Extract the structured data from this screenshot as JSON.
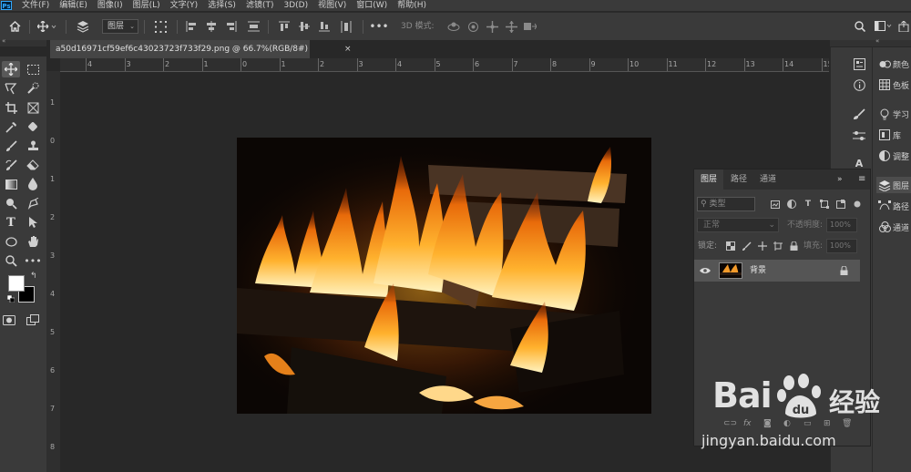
{
  "app": {
    "logo": "Ps"
  },
  "menu": [
    "文件(F)",
    "编辑(E)",
    "图像(I)",
    "图层(L)",
    "文字(Y)",
    "选择(S)",
    "滤镜(T)",
    "3D(D)",
    "视图(V)",
    "窗口(W)",
    "帮助(H)"
  ],
  "options": {
    "auto_select_target": "图层",
    "mode_3d_label": "3D 模式:",
    "icons": [
      "home-icon",
      "move-tool-icon",
      "layer-stack-icon",
      "transform-controls-icon",
      "align-left-icon",
      "align-center-icon",
      "align-right-icon",
      "distribute-icon",
      "align-top-icon",
      "align-middle-icon",
      "align-bottom-icon",
      "distribute-vertical-icon",
      "more-icon",
      "orbit-3d-icon",
      "roll-3d-icon",
      "pan-3d-icon",
      "slide-3d-icon",
      "scale-3d-icon",
      "search-icon",
      "workspace-icon",
      "share-icon"
    ]
  },
  "document": {
    "tab_title": "a50d16971cf59ef6c43023723f733f29.png @ 66.7%(RGB/8#) *",
    "close": "×"
  },
  "rulers": {
    "horizontal": [
      "4",
      "3",
      "2",
      "1",
      "0",
      "1",
      "2",
      "3",
      "4",
      "5",
      "6",
      "7",
      "8",
      "9",
      "10",
      "11",
      "12",
      "13",
      "14",
      "15"
    ],
    "vertical": [
      "1",
      "0",
      "1",
      "2",
      "3",
      "4",
      "5",
      "6",
      "7",
      "8"
    ]
  },
  "tools": [
    "move-tool",
    "marquee-tool",
    "lasso-tool",
    "quick-select-tool",
    "crop-tool",
    "frame-tool",
    "eyedropper-tool",
    "healing-brush-tool",
    "brush-tool",
    "clone-stamp-tool",
    "history-brush-tool",
    "eraser-tool",
    "gradient-tool",
    "blur-tool",
    "dodge-tool",
    "pen-tool",
    "type-tool",
    "path-select-tool",
    "ellipse-tool",
    "hand-tool",
    "zoom-tool",
    "more-tools",
    "quick-mask",
    "screen-mode"
  ],
  "colors": {
    "foreground": "#ffffff",
    "background": "#000000",
    "ui_bg": "#3a3a3a",
    "canvas_bg": "#282828"
  },
  "right_panels": {
    "labels": [
      {
        "icon": "color-icon",
        "label": "颜色"
      },
      {
        "icon": "swatches-icon",
        "label": "色板"
      },
      {
        "icon": "learn-icon",
        "label": "学习"
      },
      {
        "icon": "libraries-icon",
        "label": "库"
      },
      {
        "icon": "adjustments-icon",
        "label": "调整"
      },
      {
        "icon": "layers-icon",
        "label": "图层"
      },
      {
        "icon": "paths-icon",
        "label": "路径"
      },
      {
        "icon": "channels-icon",
        "label": "通道"
      }
    ]
  },
  "layers_panel": {
    "tabs": [
      "图层",
      "路径",
      "通道"
    ],
    "search_placeholder": "类型",
    "blend_mode": "正常",
    "opacity_label": "不透明度:",
    "opacity_value": "100%",
    "lock_label": "锁定:",
    "fill_label": "填充:",
    "fill_value": "100%",
    "layers": [
      {
        "name": "背景",
        "visible": true,
        "locked": true
      }
    ],
    "footer": [
      "链接",
      "fx",
      "蒙版",
      "调整",
      "组",
      "新建",
      "删除"
    ]
  },
  "watermark": {
    "logo_text": "Bai",
    "cn_text": "经验",
    "url": "jingyan.baidu.com"
  }
}
